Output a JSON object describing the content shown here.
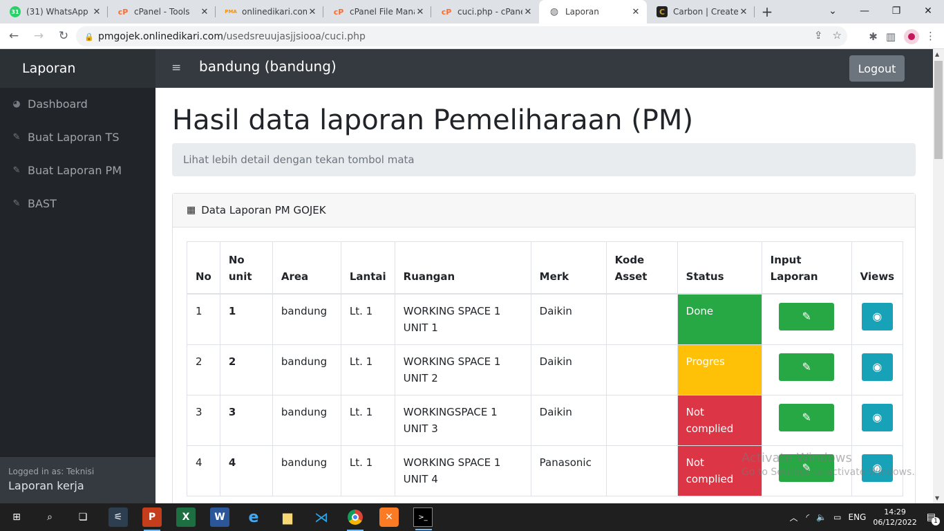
{
  "browser": {
    "tabs": [
      {
        "title": "(31) WhatsApp",
        "icon": "whatsapp-icon",
        "badge": "31",
        "color": "#25d366"
      },
      {
        "title": "cPanel - Tools",
        "icon": "cpanel-icon",
        "badge": "cP",
        "color": "#ff6c2c"
      },
      {
        "title": "onlinedikari.com",
        "icon": "phpmyadmin-icon",
        "badge": "PMA",
        "color": "#f29111"
      },
      {
        "title": "cPanel File Manag",
        "icon": "cpanel-icon",
        "badge": "cP",
        "color": "#ff6c2c"
      },
      {
        "title": "cuci.php - cPanel",
        "icon": "cpanel-icon",
        "badge": "cP",
        "color": "#ff6c2c"
      },
      {
        "title": "Laporan",
        "icon": "globe-icon",
        "badge": "",
        "color": "#5f6368"
      },
      {
        "title": "Carbon | Create a",
        "icon": "carbon-icon",
        "badge": "C",
        "color": "#c6a02a"
      }
    ],
    "active_tab": 5,
    "url_host": "pmgojek.onlinedikari.com",
    "url_path": "/usedsreuujasjjsiooa/cuci.php"
  },
  "app": {
    "brand": "Laporan",
    "header_title": "bandung (bandung)",
    "logout_label": "Logout",
    "sidebar": {
      "items": [
        {
          "label": "Dashboard",
          "icon": "palette-icon"
        },
        {
          "label": "Buat Laporan TS",
          "icon": "edit-icon"
        },
        {
          "label": "Buat Laporan PM",
          "icon": "edit-icon"
        },
        {
          "label": "BAST",
          "icon": "edit-icon"
        }
      ],
      "footer_label": "Logged in as: Teknisi",
      "footer_value": "Laporan kerja"
    },
    "page_title": "Hasil data laporan Pemeliharaan (PM)",
    "breadcrumb": "Lihat lebih detail dengan tekan tombol mata",
    "card_title": "Data Laporan PM GOJEK",
    "table": {
      "headers": [
        "No",
        "No unit",
        "Area",
        "Lantai",
        "Ruangan",
        "Merk",
        "Kode Asset",
        "Status",
        "Input Laporan",
        "Views"
      ],
      "rows": [
        {
          "no": "1",
          "unit": "1",
          "area": "bandung",
          "lantai": "Lt. 1",
          "ruangan": "WORKING SPACE 1 UNIT 1",
          "merk": "Daikin",
          "kode": "",
          "status": "Done",
          "status_color": "#28a745"
        },
        {
          "no": "2",
          "unit": "2",
          "area": "bandung",
          "lantai": "Lt. 1",
          "ruangan": "WORKING SPACE 1 UNIT 2",
          "merk": "Daikin",
          "kode": "",
          "status": "Progres",
          "status_color": "#ffc107"
        },
        {
          "no": "3",
          "unit": "3",
          "area": "bandung",
          "lantai": "Lt. 1",
          "ruangan": "WORKINGSPACE 1 UNIT 3",
          "merk": "Daikin",
          "kode": "",
          "status": "Not complied",
          "status_color": "#dc3545"
        },
        {
          "no": "4",
          "unit": "4",
          "area": "bandung",
          "lantai": "Lt. 1",
          "ruangan": "WORKING SPACE 1 UNIT 4",
          "merk": "Panasonic",
          "kode": "",
          "status": "Not complied",
          "status_color": "#dc3545"
        }
      ]
    }
  },
  "watermark": {
    "line1": "Activate Windows",
    "line2": "Go to Settings to activate Windows."
  },
  "taskbar": {
    "apps": [
      "windows-start-icon",
      "search-icon",
      "task-view-icon",
      "network-app-icon",
      "powerpoint-icon",
      "excel-icon",
      "word-icon",
      "edge-icon",
      "file-explorer-icon",
      "vscode-icon",
      "chrome-icon",
      "xampp-icon",
      "terminal-icon"
    ],
    "language": "ENG",
    "time": "14:29",
    "date": "06/12/2022",
    "notification_count": "1"
  }
}
